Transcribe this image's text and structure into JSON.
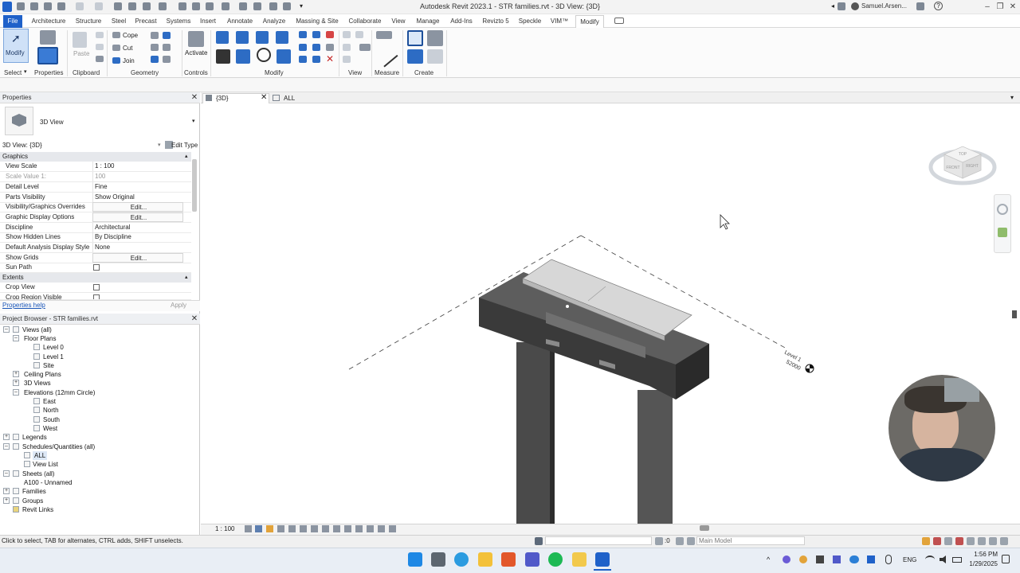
{
  "app": {
    "window_title": "Autodesk Revit 2023.1 - STR families.rvt - 3D View: {3D}",
    "user": "Samuel.Arsen...",
    "window_controls": [
      "minimize-icon",
      "restore-icon",
      "close-icon"
    ]
  },
  "ribbon_tabs": [
    "File",
    "Architecture",
    "Structure",
    "Steel",
    "Precast",
    "Systems",
    "Insert",
    "Annotate",
    "Analyze",
    "Massing & Site",
    "Collaborate",
    "View",
    "Manage",
    "Add-Ins",
    "Revizto 5",
    "Speckle",
    "VIM™",
    "Modify"
  ],
  "ribbon": {
    "modify_label": "Modify",
    "paste_label": "Paste",
    "cope_label": "Cope",
    "cut_label": "Cut",
    "join_label": "Join",
    "activate_label": "Activate",
    "panels": [
      "Select",
      "Properties",
      "Clipboard",
      "Geometry",
      "Controls",
      "Modify",
      "View",
      "Measure",
      "Create"
    ]
  },
  "properties": {
    "title": "Properties",
    "type_name": "3D View",
    "selector": "3D View: {3D}",
    "edit_type": "Edit Type",
    "sections": {
      "graphics": "Graphics",
      "extents": "Extents"
    },
    "rows": [
      {
        "key": "View Scale",
        "value": "1 : 100"
      },
      {
        "key": "Scale Value    1:",
        "value": "100"
      },
      {
        "key": "Detail Level",
        "value": "Fine"
      },
      {
        "key": "Parts Visibility",
        "value": "Show Original"
      },
      {
        "key": "Visibility/Graphics Overrides",
        "value": "Edit..."
      },
      {
        "key": "Graphic Display Options",
        "value": "Edit..."
      },
      {
        "key": "Discipline",
        "value": "Architectural"
      },
      {
        "key": "Show Hidden Lines",
        "value": "By Discipline"
      },
      {
        "key": "Default Analysis Display Style",
        "value": "None"
      },
      {
        "key": "Show Grids",
        "value": "Edit..."
      },
      {
        "key": "Sun Path",
        "value": ""
      }
    ],
    "extents_rows": [
      {
        "key": "Crop View",
        "value": ""
      },
      {
        "key": "Crop Region Visible",
        "value": ""
      }
    ],
    "help_link": "Properties help",
    "apply": "Apply"
  },
  "project_browser": {
    "title": "Project Browser - STR families.rvt",
    "items": [
      "Views (all)",
      "Floor Plans",
      "Level 0",
      "Level 1",
      "Site",
      "Ceiling Plans",
      "3D Views",
      "Elevations (12mm Circle)",
      "East",
      "North",
      "South",
      "West",
      "Legends",
      "Schedules/Quantities (all)",
      "ALL",
      "View List",
      "Sheets (all)",
      "A100 - Unnamed",
      "Families",
      "Groups",
      "Revit Links"
    ]
  },
  "view_tabs": [
    "{3D}",
    "ALL"
  ],
  "viewcube": {
    "top": "TOP",
    "front": "FRONT",
    "right": "RIGHT"
  },
  "level_tag": {
    "name": "Level 1",
    "elevation": "52000"
  },
  "view_scale": "1 : 100",
  "status": {
    "hint": "Click to select, TAB for alternates, CTRL adds, SHIFT unselects.",
    "zero": ":0",
    "model": "Main Model"
  },
  "taskbar": {
    "language": "ENG",
    "time": "1:56 PM",
    "date": "1/29/2025"
  }
}
